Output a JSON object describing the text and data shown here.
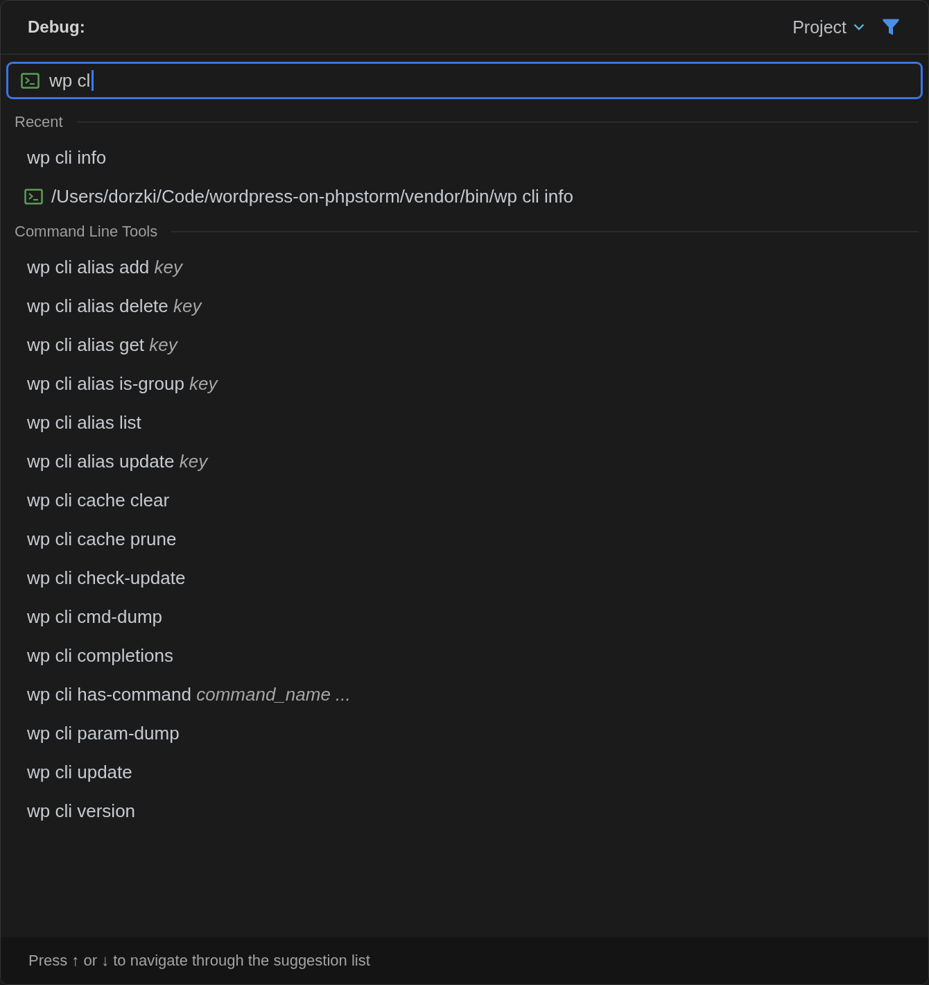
{
  "header": {
    "title": "Debug:",
    "scope": {
      "label": "Project"
    }
  },
  "search": {
    "value": "wp cl"
  },
  "sections": [
    {
      "title": "Recent",
      "items": [
        {
          "kind": "command",
          "text": "wp cli info"
        },
        {
          "kind": "run_config",
          "text": "/Users/dorzki/Code/wordpress-on-phpstorm/vendor/bin/wp cli info"
        }
      ]
    },
    {
      "title": "Command Line Tools",
      "items": [
        {
          "kind": "command",
          "text": "wp cli alias add *key*"
        },
        {
          "kind": "command",
          "text": "wp cli alias delete *key*"
        },
        {
          "kind": "command",
          "text": "wp cli alias get *key*"
        },
        {
          "kind": "command",
          "text": "wp cli alias is-group *key*"
        },
        {
          "kind": "command",
          "text": "wp cli alias list"
        },
        {
          "kind": "command",
          "text": "wp cli alias update *key*"
        },
        {
          "kind": "command",
          "text": "wp cli cache clear"
        },
        {
          "kind": "command",
          "text": "wp cli cache prune"
        },
        {
          "kind": "command",
          "text": "wp cli check-update"
        },
        {
          "kind": "command",
          "text": "wp cli cmd-dump"
        },
        {
          "kind": "command",
          "text": "wp cli completions"
        },
        {
          "kind": "command",
          "text": "wp cli has-command *command_name ...*"
        },
        {
          "kind": "command",
          "text": "wp cli param-dump"
        },
        {
          "kind": "command",
          "text": "wp cli update"
        },
        {
          "kind": "command",
          "text": "wp cli version"
        }
      ]
    }
  ],
  "footer": {
    "hint": "Press ↑ or ↓ to navigate through the suggestion list"
  }
}
